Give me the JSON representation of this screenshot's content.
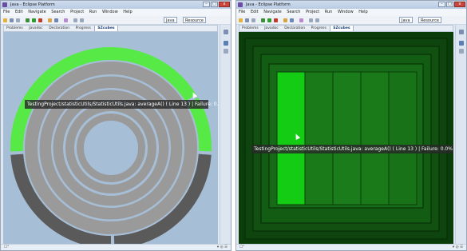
{
  "window": {
    "title": "Java - Eclipse Platform",
    "controls": {
      "minimize": "–",
      "maximize": "□",
      "close": "x"
    }
  },
  "menu": [
    "File",
    "Edit",
    "Navigate",
    "Search",
    "Project",
    "Run",
    "Window",
    "Help"
  ],
  "toolbar": {
    "perspective_java": "Java",
    "perspective_resource": "Resource"
  },
  "tabs": [
    "Problems",
    "Javadoc",
    "Declaration",
    "Progress",
    "SZcubes"
  ],
  "tooltip": "TestingProject/statisticUtils/StatisticUtils.java: averageA() ( Line 13 ) | Failure: 0.0%",
  "colors": {
    "bright_green": "#57ea46",
    "ring_gray": "#9a9a9a",
    "ring_separator": "#a7bed7",
    "dark_ring": "#5a5a5a",
    "dark_green_bg": "#0b3d0b",
    "treemap_highlight": "#15cc15"
  },
  "status": {
    "left": "☐°",
    "right": "▾ ◎ ☰"
  },
  "icons": [
    "eclipse-app-icon",
    "new-icon",
    "save-icon",
    "run-icon",
    "debug-icon",
    "search-icon",
    "perspective-icon"
  ]
}
